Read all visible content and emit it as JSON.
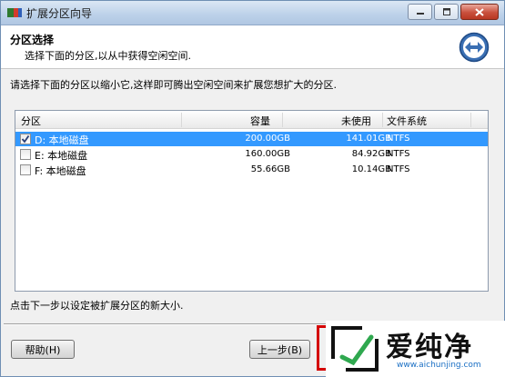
{
  "window": {
    "title": "扩展分区向导"
  },
  "header": {
    "title": "分区选择",
    "subtitle": "选择下面的分区,以从中获得空闲空间."
  },
  "instruction": "请选择下面的分区以缩小它,这样即可腾出空闲空间来扩展您想扩大的分区.",
  "table": {
    "columns": [
      "分区",
      "容量",
      "未使用",
      "文件系统"
    ],
    "rows": [
      {
        "name": "D: 本地磁盘",
        "capacity": "200.00GB",
        "free": "141.01GB",
        "fs": "NTFS",
        "checked": true,
        "selected": true
      },
      {
        "name": "E: 本地磁盘",
        "capacity": "160.00GB",
        "free": "84.92GB",
        "fs": "NTFS",
        "checked": false,
        "selected": false
      },
      {
        "name": "F: 本地磁盘",
        "capacity": "55.66GB",
        "free": "10.14GB",
        "fs": "NTFS",
        "checked": false,
        "selected": false
      }
    ]
  },
  "footer_note": "点击下一步以设定被扩展分区的新大小.",
  "buttons": {
    "help": "帮助(H)",
    "back": "上一步(B)"
  },
  "watermark": {
    "text": "爱纯净",
    "url": "www.aichunjing.com"
  },
  "colors": {
    "selection": "#3399ff",
    "highlight_frame": "#d40000"
  }
}
